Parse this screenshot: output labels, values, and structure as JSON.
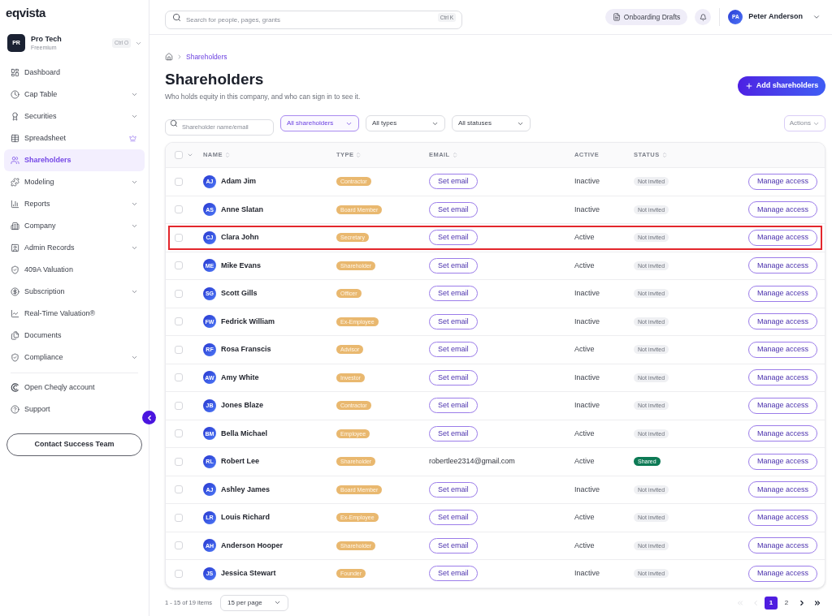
{
  "sidebar": {
    "logo": "eqvista",
    "org": {
      "initials": "PR",
      "name": "Pro Tech",
      "plan": "Freemium",
      "shortcut": "Ctrl O"
    },
    "nav": [
      {
        "label": "Dashboard",
        "expandable": false,
        "selected": false,
        "premium": false
      },
      {
        "label": "Cap Table",
        "expandable": true,
        "selected": false,
        "premium": false
      },
      {
        "label": "Securities",
        "expandable": true,
        "selected": false,
        "premium": false
      },
      {
        "label": "Spreadsheet",
        "expandable": false,
        "selected": false,
        "premium": true
      },
      {
        "label": "Shareholders",
        "expandable": false,
        "selected": true,
        "premium": false
      },
      {
        "label": "Modeling",
        "expandable": true,
        "selected": false,
        "premium": false
      },
      {
        "label": "Reports",
        "expandable": true,
        "selected": false,
        "premium": false
      },
      {
        "label": "Company",
        "expandable": true,
        "selected": false,
        "premium": false
      },
      {
        "label": "Admin Records",
        "expandable": true,
        "selected": false,
        "premium": false
      },
      {
        "label": "409A Valuation",
        "expandable": false,
        "selected": false,
        "premium": false
      },
      {
        "label": "Subscription",
        "expandable": true,
        "selected": false,
        "premium": false
      },
      {
        "label": "Real-Time Valuation®",
        "expandable": false,
        "selected": false,
        "premium": false
      },
      {
        "label": "Documents",
        "expandable": false,
        "selected": false,
        "premium": false
      },
      {
        "label": "Compliance",
        "expandable": true,
        "selected": false,
        "premium": false
      }
    ],
    "links": [
      {
        "label": "Open Cheqly account"
      },
      {
        "label": "Support"
      }
    ],
    "contact_button": "Contact Success Team"
  },
  "topbar": {
    "search": {
      "placeholder": "Search for people, pages, grants",
      "shortcut": "Ctrl K"
    },
    "drafts_button": "Onboarding Drafts",
    "user": {
      "initials": "PA",
      "name": "Peter Anderson"
    }
  },
  "breadcrumb": [
    "Shareholders"
  ],
  "page": {
    "title": "Shareholders",
    "subtitle": "Who holds equity in this company, and who can sign in to see it.",
    "add_button": "Add shareholders"
  },
  "filters": {
    "search": {
      "placeholder": "Shareholder name/email"
    },
    "selects": [
      {
        "value": "All shareholders",
        "active": true
      },
      {
        "value": "All types",
        "active": false
      },
      {
        "value": "All statuses",
        "active": false
      }
    ],
    "actions_button": "Actions"
  },
  "table": {
    "select_all": {
      "checked": false
    },
    "columns": [
      {
        "label": "NAME",
        "sortable": true
      },
      {
        "label": "TYPE",
        "sortable": true
      },
      {
        "label": "EMAIL",
        "sortable": true
      },
      {
        "label": "ACTIVE",
        "sortable": false
      },
      {
        "label": "STATUS",
        "sortable": true
      }
    ],
    "rows": [
      {
        "checked": false,
        "highlighted": false,
        "initials": "AJ",
        "name": "Adam Jim",
        "type": "Contractor",
        "email": {
          "kind": "button",
          "text": "Set email"
        },
        "activity": "Inactive",
        "status": {
          "kind": "neutral",
          "text": "Not invited"
        },
        "action": "Manage access"
      },
      {
        "checked": false,
        "highlighted": false,
        "initials": "AS",
        "name": "Anne Slatan",
        "type": "Board Member",
        "email": {
          "kind": "button",
          "text": "Set email"
        },
        "activity": "Inactive",
        "status": {
          "kind": "neutral",
          "text": "Not invited"
        },
        "action": "Manage access"
      },
      {
        "checked": false,
        "highlighted": true,
        "initials": "CJ",
        "name": "Clara John",
        "type": "Secretary",
        "email": {
          "kind": "button",
          "text": "Set email"
        },
        "activity": "Active",
        "status": {
          "kind": "neutral",
          "text": "Not invited"
        },
        "action": "Manage access"
      },
      {
        "checked": false,
        "highlighted": false,
        "initials": "ME",
        "name": "Mike Evans",
        "type": "Shareholder",
        "email": {
          "kind": "button",
          "text": "Set email"
        },
        "activity": "Active",
        "status": {
          "kind": "neutral",
          "text": "Not invited"
        },
        "action": "Manage access"
      },
      {
        "checked": false,
        "highlighted": false,
        "initials": "SG",
        "name": "Scott Gills",
        "type": "Officer",
        "email": {
          "kind": "button",
          "text": "Set email"
        },
        "activity": "Inactive",
        "status": {
          "kind": "neutral",
          "text": "Not invited"
        },
        "action": "Manage access"
      },
      {
        "checked": false,
        "highlighted": false,
        "initials": "FW",
        "name": "Fedrick William",
        "type": "Ex-Employee",
        "email": {
          "kind": "button",
          "text": "Set email"
        },
        "activity": "Inactive",
        "status": {
          "kind": "neutral",
          "text": "Not invited"
        },
        "action": "Manage access"
      },
      {
        "checked": false,
        "highlighted": false,
        "initials": "RF",
        "name": "Rosa Franscis",
        "type": "Advisor",
        "email": {
          "kind": "button",
          "text": "Set email"
        },
        "activity": "Active",
        "status": {
          "kind": "neutral",
          "text": "Not invited"
        },
        "action": "Manage access"
      },
      {
        "checked": false,
        "highlighted": false,
        "initials": "AW",
        "name": "Amy White",
        "type": "Investor",
        "email": {
          "kind": "button",
          "text": "Set email"
        },
        "activity": "Inactive",
        "status": {
          "kind": "neutral",
          "text": "Not invited"
        },
        "action": "Manage access"
      },
      {
        "checked": false,
        "highlighted": false,
        "initials": "JB",
        "name": "Jones Blaze",
        "type": "Contractor",
        "email": {
          "kind": "button",
          "text": "Set email"
        },
        "activity": "Inactive",
        "status": {
          "kind": "neutral",
          "text": "Not invited"
        },
        "action": "Manage access"
      },
      {
        "checked": false,
        "highlighted": false,
        "initials": "BM",
        "name": "Bella Michael",
        "type": "Employee",
        "email": {
          "kind": "button",
          "text": "Set email"
        },
        "activity": "Active",
        "status": {
          "kind": "neutral",
          "text": "Not invited"
        },
        "action": "Manage access"
      },
      {
        "checked": false,
        "highlighted": false,
        "initials": "RL",
        "name": "Robert Lee",
        "type": "Shareholder",
        "email": {
          "kind": "text",
          "text": "robertlee2314@gmail.com"
        },
        "activity": "Active",
        "status": {
          "kind": "success",
          "text": "Shared"
        },
        "action": "Manage access"
      },
      {
        "checked": false,
        "highlighted": false,
        "initials": "AJ",
        "name": "Ashley James",
        "type": "Board Member",
        "email": {
          "kind": "button",
          "text": "Set email"
        },
        "activity": "Inactive",
        "status": {
          "kind": "neutral",
          "text": "Not invited"
        },
        "action": "Manage access"
      },
      {
        "checked": false,
        "highlighted": false,
        "initials": "LR",
        "name": "Louis Richard",
        "type": "Ex-Employee",
        "email": {
          "kind": "button",
          "text": "Set email"
        },
        "activity": "Active",
        "status": {
          "kind": "neutral",
          "text": "Not invited"
        },
        "action": "Manage access"
      },
      {
        "checked": false,
        "highlighted": false,
        "initials": "AH",
        "name": "Anderson Hooper",
        "type": "Shareholder",
        "email": {
          "kind": "button",
          "text": "Set email"
        },
        "activity": "Active",
        "status": {
          "kind": "neutral",
          "text": "Not invited"
        },
        "action": "Manage access"
      },
      {
        "checked": false,
        "highlighted": false,
        "initials": "JS",
        "name": "Jessica Stewart",
        "type": "Founder",
        "email": {
          "kind": "button",
          "text": "Set email"
        },
        "activity": "Inactive",
        "status": {
          "kind": "neutral",
          "text": "Not invited"
        },
        "action": "Manage access"
      }
    ]
  },
  "pagination": {
    "summary": "1 - 15 of 19 items",
    "per_page": "15 per page",
    "nav_buttons": [
      {
        "kind": "first",
        "disabled": true
      },
      {
        "kind": "prev",
        "disabled": true
      },
      {
        "kind": "next",
        "disabled": false
      },
      {
        "kind": "last",
        "disabled": false
      }
    ],
    "pages": [
      {
        "label": "1",
        "selected": true
      },
      {
        "label": "2",
        "selected": false
      }
    ]
  }
}
